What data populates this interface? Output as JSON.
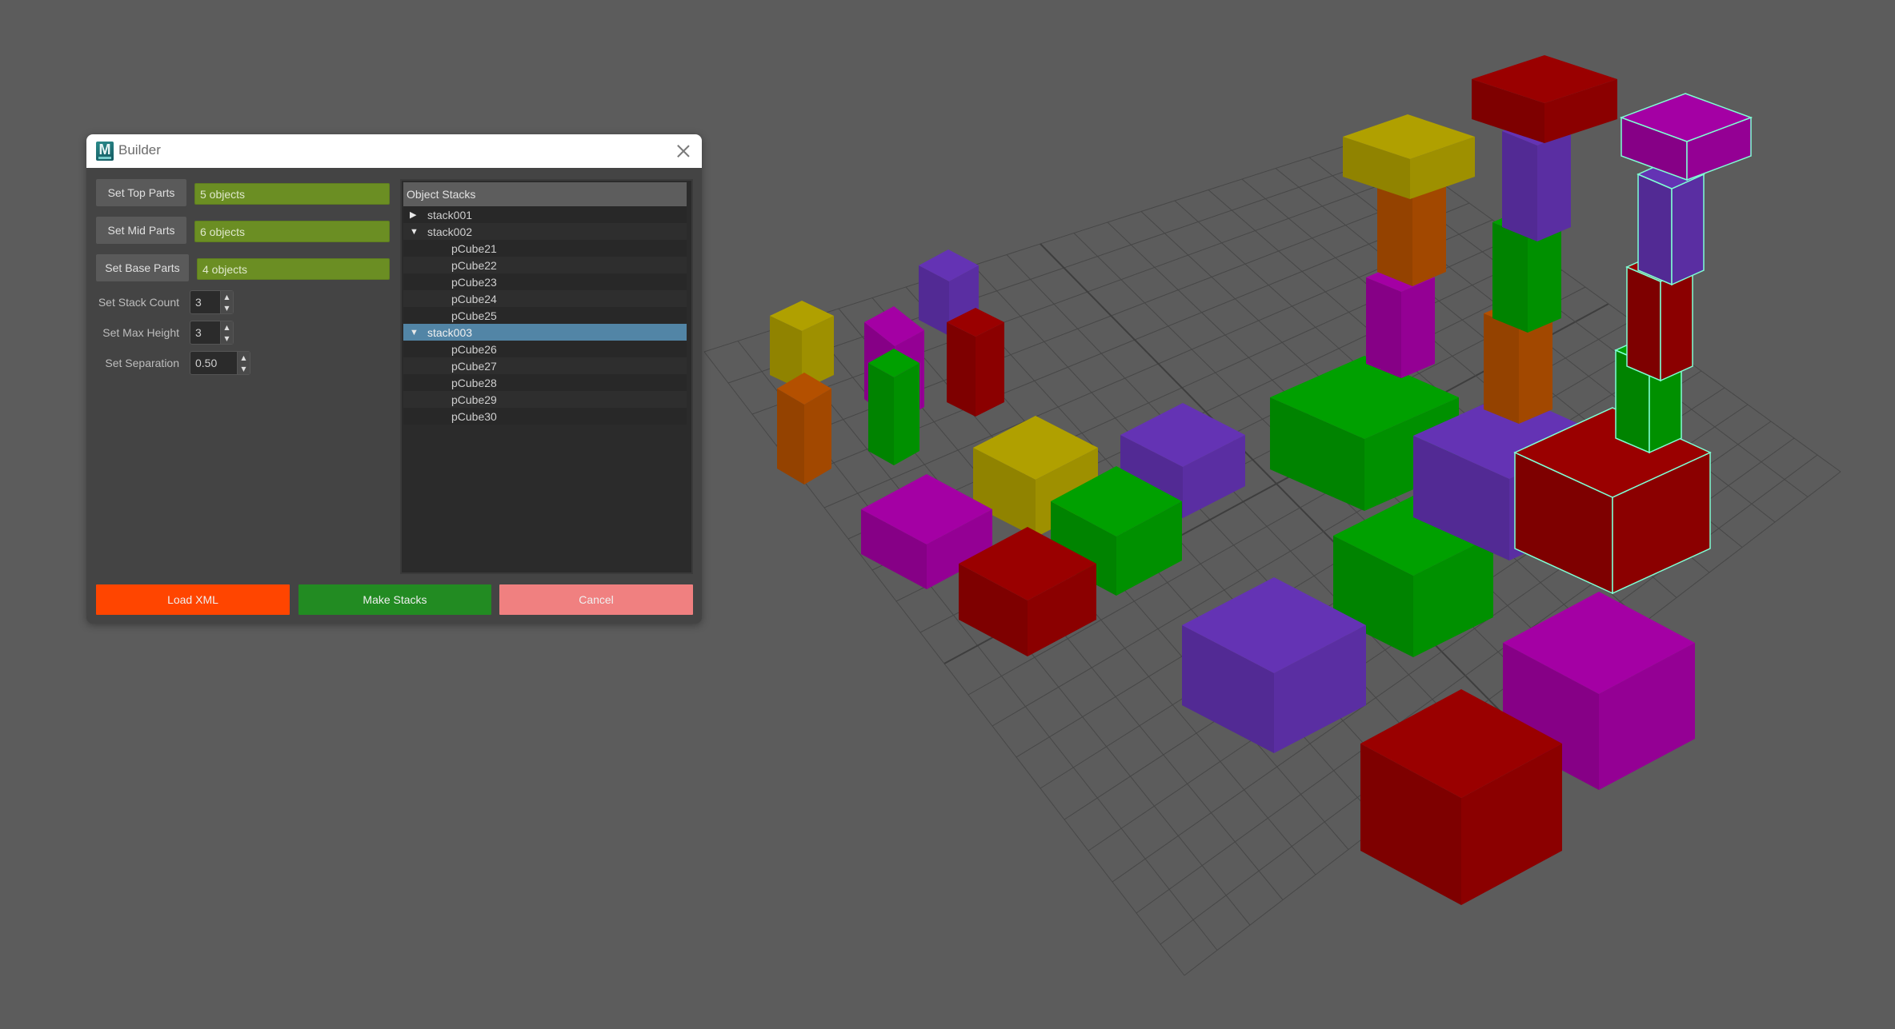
{
  "window": {
    "title": "Builder",
    "app_icon": "maya-logo-icon",
    "close_icon": "close-icon"
  },
  "parts": {
    "top": {
      "button_label": "Set Top Parts",
      "field_value": "5 objects"
    },
    "mid": {
      "button_label": "Set Mid Parts",
      "field_value": "6 objects"
    },
    "base": {
      "button_label": "Set Base Parts",
      "field_value": "4 objects"
    }
  },
  "settings": {
    "stack_count": {
      "label": "Set Stack Count",
      "value": "3"
    },
    "max_height": {
      "label": "Set Max Height",
      "value": "3"
    },
    "separation": {
      "label": "Set Separation",
      "value": "0.50"
    }
  },
  "tree": {
    "header": "Object Stacks",
    "rows": [
      {
        "label": "stack001",
        "level": 0,
        "expanded": false,
        "selected": false
      },
      {
        "label": "stack002",
        "level": 0,
        "expanded": true,
        "selected": false
      },
      {
        "label": "pCube21",
        "level": 1
      },
      {
        "label": "pCube22",
        "level": 1
      },
      {
        "label": "pCube23",
        "level": 1
      },
      {
        "label": "pCube24",
        "level": 1
      },
      {
        "label": "pCube25",
        "level": 1
      },
      {
        "label": "stack003",
        "level": 0,
        "expanded": true,
        "selected": true
      },
      {
        "label": "pCube26",
        "level": 1
      },
      {
        "label": "pCube27",
        "level": 1
      },
      {
        "label": "pCube28",
        "level": 1
      },
      {
        "label": "pCube29",
        "level": 1
      },
      {
        "label": "pCube30",
        "level": 1
      }
    ]
  },
  "actions": {
    "load_xml": "Load XML",
    "make_stacks": "Make Stacks",
    "cancel": "Cancel"
  },
  "colors": {
    "viewport_bg": "#5c5c5c",
    "field_green": "#6b8e23",
    "selection_blue": "#5285a6",
    "load_xml_bg": "#ff4500",
    "make_stacks_bg": "#228b22",
    "cancel_bg": "#f08080",
    "selected_wire": "#7fffd4",
    "cube_palette": {
      "red": "#9a0000",
      "magenta": "#a400a4",
      "purple": "#6433b4",
      "green": "#00a000",
      "yellow": "#b0a000",
      "orange": "#b45000"
    }
  },
  "viewport": {
    "stacks_built": 3,
    "selected_stack": "stack003"
  }
}
